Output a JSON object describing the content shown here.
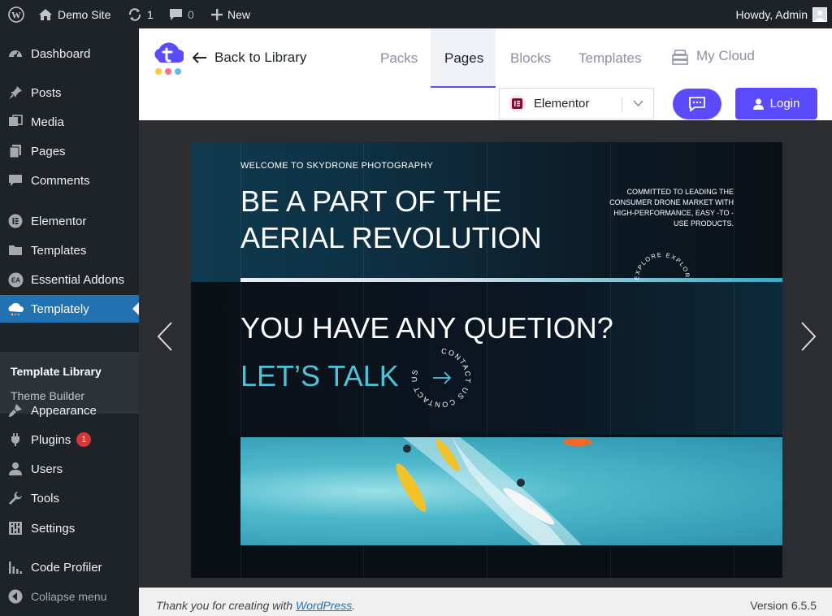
{
  "adminbar": {
    "site_name": "Demo Site",
    "updates_count": "1",
    "comments_count": "0",
    "new_label": "New",
    "howdy": "Howdy, Admin"
  },
  "sidebar": {
    "items": [
      {
        "label": "Dashboard",
        "icon": "dashboard-icon"
      },
      {
        "label": "Posts",
        "icon": "pin-icon"
      },
      {
        "label": "Media",
        "icon": "media-icon"
      },
      {
        "label": "Pages",
        "icon": "pages-icon"
      },
      {
        "label": "Comments",
        "icon": "comment-icon"
      },
      {
        "label": "Elementor",
        "icon": "elementor-icon"
      },
      {
        "label": "Templates",
        "icon": "folder-icon"
      },
      {
        "label": "Essential Addons",
        "icon": "ea-icon"
      },
      {
        "label": "Templately",
        "icon": "templately-icon"
      },
      {
        "label": "Appearance",
        "icon": "brush-icon"
      },
      {
        "label": "Plugins",
        "icon": "plug-icon",
        "badge": "1"
      },
      {
        "label": "Users",
        "icon": "user-icon"
      },
      {
        "label": "Tools",
        "icon": "wrench-icon"
      },
      {
        "label": "Settings",
        "icon": "settings-icon"
      },
      {
        "label": "Code Profiler",
        "icon": "bars-icon"
      }
    ],
    "submenu": [
      "Template Library",
      "Theme Builder"
    ],
    "collapse_label": "Collapse menu"
  },
  "templately": {
    "back_label": "Back to Library",
    "tabs": [
      "Packs",
      "Pages",
      "Blocks",
      "Templates",
      "My Cloud"
    ],
    "active_tab": "Pages",
    "builder_selected": "Elementor",
    "login_label": "Login"
  },
  "preview": {
    "welcome": "WELCOME TO SKYDRONE PHOTOGRAPHY",
    "headline": "BE A PART OF THE AERIAL REVOLUTION",
    "committed": "COMMITTED TO LEADING THE CONSUMER DRONE MARKET WITH HIGH-PERFORMANCE, EASY -TO -USE PRODUCTS.",
    "explore_badge": "EXPLORE EXPLORE",
    "question": "YOU HAVE ANY QUETION?",
    "talk": "LET’S TALK",
    "contact_badge": "CONTACT US CONTACT US"
  },
  "footer": {
    "thanks_prefix": "Thank you for creating with ",
    "wp_link": "WordPress",
    "thanks_suffix": ".",
    "version": "Version 6.5.5"
  },
  "colors": {
    "sidebar_bg": "#1d2327",
    "active_bg": "#2271b1",
    "accent": "#5b4bff",
    "teal": "#4ec3d8"
  }
}
